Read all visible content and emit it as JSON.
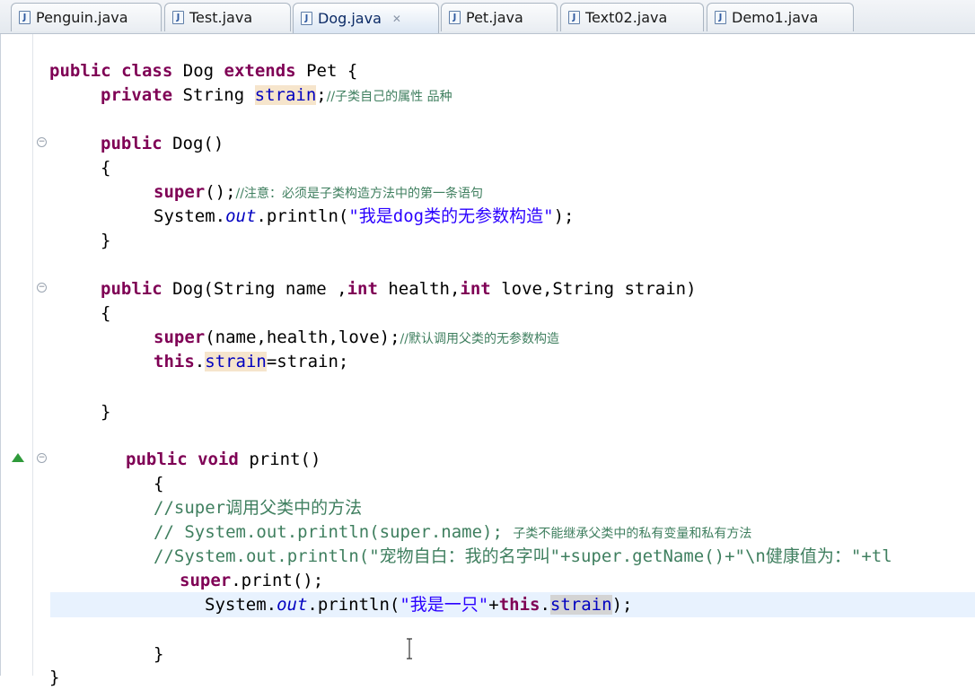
{
  "tabs": [
    {
      "label": "Penguin.java",
      "active": false
    },
    {
      "label": "Test.java",
      "active": false
    },
    {
      "label": "Dog.java",
      "active": true
    },
    {
      "label": "Pet.java",
      "active": false
    },
    {
      "label": "Text02.java",
      "active": false
    },
    {
      "label": "Demo1.java",
      "active": false
    }
  ],
  "icons": {
    "file": "java-file-icon",
    "close": "close-icon",
    "fold": "fold-toggle-icon",
    "override": "override-indicator-icon",
    "cursor": "text-cursor-icon"
  },
  "code": {
    "l1": {
      "k1": "public",
      "k2": "class",
      "t1": "Dog",
      "k3": "extends",
      "t2": "Pet {"
    },
    "l2": {
      "k1": "private",
      "t1": "String",
      "f1": "strain",
      "p1": ";",
      "c1": "//子类自己的属性 品种"
    },
    "l3": {
      "k1": "public",
      "t1": "Dog()"
    },
    "l4": {
      "t1": "{"
    },
    "l5": {
      "k1": "super",
      "t1": "();",
      "c1": "//注意：必须是子类构造方法中的第一条语句"
    },
    "l6": {
      "t1": "System.",
      "s1": "out",
      "t2": ".println(",
      "q1": "\"我是dog类的无参数构造\"",
      "t3": ");"
    },
    "l7": {
      "t1": "}"
    },
    "l8": {
      "k1": "public",
      "t1": "Dog(String name ,",
      "k2": "int",
      "t2": "health,",
      "k3": "int",
      "t3": "love,String strain)"
    },
    "l9": {
      "t1": "{"
    },
    "l10": {
      "k1": "super",
      "t1": "(name,health,love);",
      "c1": "//默认调用父类的无参数构造"
    },
    "l11": {
      "k1": "this",
      "t1": ".",
      "f1": "strain",
      "t2": "=strain;"
    },
    "l12": {
      "t1": "}"
    },
    "l13": {
      "k1": "public",
      "k2": "void",
      "t1": "print()"
    },
    "l14": {
      "t1": "{"
    },
    "l15": {
      "c1": "//super调用父类中的方法"
    },
    "l16": {
      "c1": "// System.out.println(super.name);",
      "c2": "子类不能继承父类中的私有变量和私有方法"
    },
    "l17": {
      "c1": "//System.out.println(\"宠物自白：我的名字叫\"+super.getName()+\"\\n健康值为：\"+tl"
    },
    "l18": {
      "k1": "super",
      "t1": ".print();"
    },
    "l19": {
      "t1": "System.",
      "s1": "out",
      "t2": ".println(",
      "q1": "\"我是一只\"",
      "t3": "+",
      "k1": "this",
      "t4": ".",
      "f1": "strain",
      "t5": ");"
    },
    "l20": {
      "t1": "}"
    },
    "l21": {
      "t1": "}"
    }
  }
}
